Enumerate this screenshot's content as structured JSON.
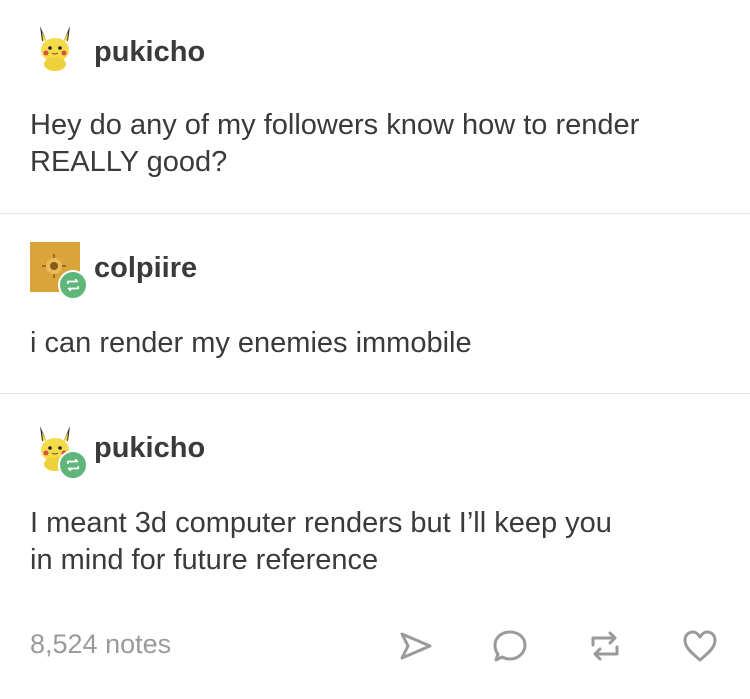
{
  "posts": [
    {
      "username": "pukicho",
      "avatar": "pikachu-avatar-icon",
      "reblogged": false,
      "text_lines": [
        "Hey do any of my followers know how to render",
        "REALLY good?"
      ]
    },
    {
      "username": "colpiire",
      "avatar": "golden-emblem-avatar-icon",
      "reblogged": true,
      "text_lines": [
        "i can render my enemies immobile"
      ]
    },
    {
      "username": "pukicho",
      "avatar": "pikachu-avatar-icon",
      "reblogged": true,
      "text_lines": [
        "I meant 3d computer renders but I’ll keep you",
        "in mind for future reference"
      ]
    }
  ],
  "footer": {
    "notes": "8,524 notes",
    "actions": [
      "share-icon",
      "reply-icon",
      "reblog-icon",
      "like-icon"
    ]
  },
  "colors": {
    "text": "#3a3a3a",
    "muted": "#9a9a9a",
    "reblog_badge": "#5fb67a",
    "divider": "#e5e5e5"
  }
}
